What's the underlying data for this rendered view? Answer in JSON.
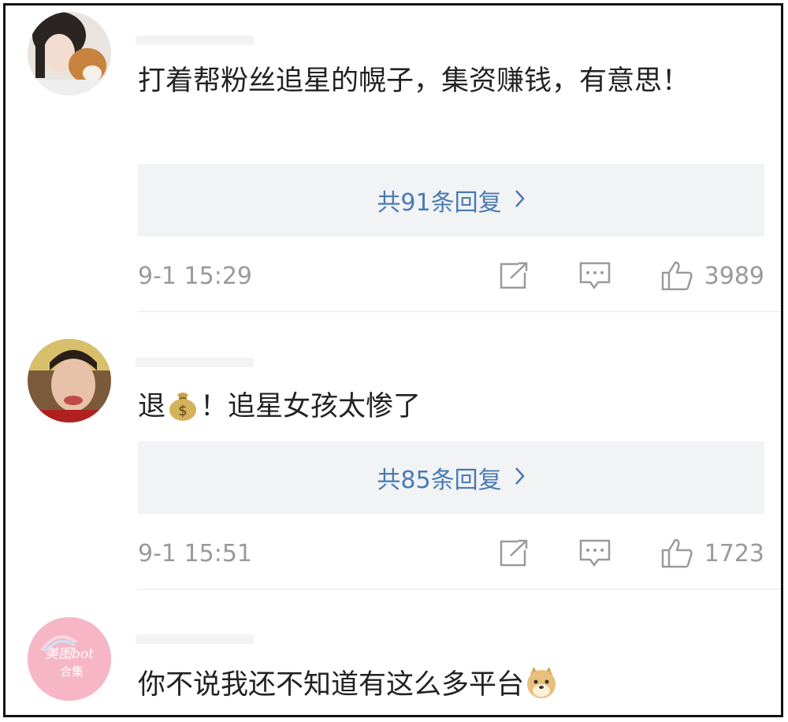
{
  "comments": [
    {
      "text": "打着帮粉丝追星的幌子，集资赚钱，有意思！",
      "replies_label": "共91条回复",
      "time": "9-1 15:29",
      "likes": "3989"
    },
    {
      "text_before": "退",
      "emoji": "money-bag",
      "text_after": "！追星女孩太惨了",
      "replies_label": "共85条回复",
      "time": "9-1 15:51",
      "likes": "1723"
    },
    {
      "text": "你不说我还不知道有这么多平台",
      "emoji": "doge",
      "avatar_text_line1": "美图bot",
      "avatar_text_line2": "合集"
    }
  ],
  "icons": {
    "share": "share-icon",
    "reply": "comment-icon",
    "like": "thumbs-up-icon",
    "chevron": "chevron-right-icon"
  },
  "colors": {
    "link": "#4a7ab3",
    "meta": "#9a9a9a",
    "reply_bg": "#f2f3f5"
  }
}
